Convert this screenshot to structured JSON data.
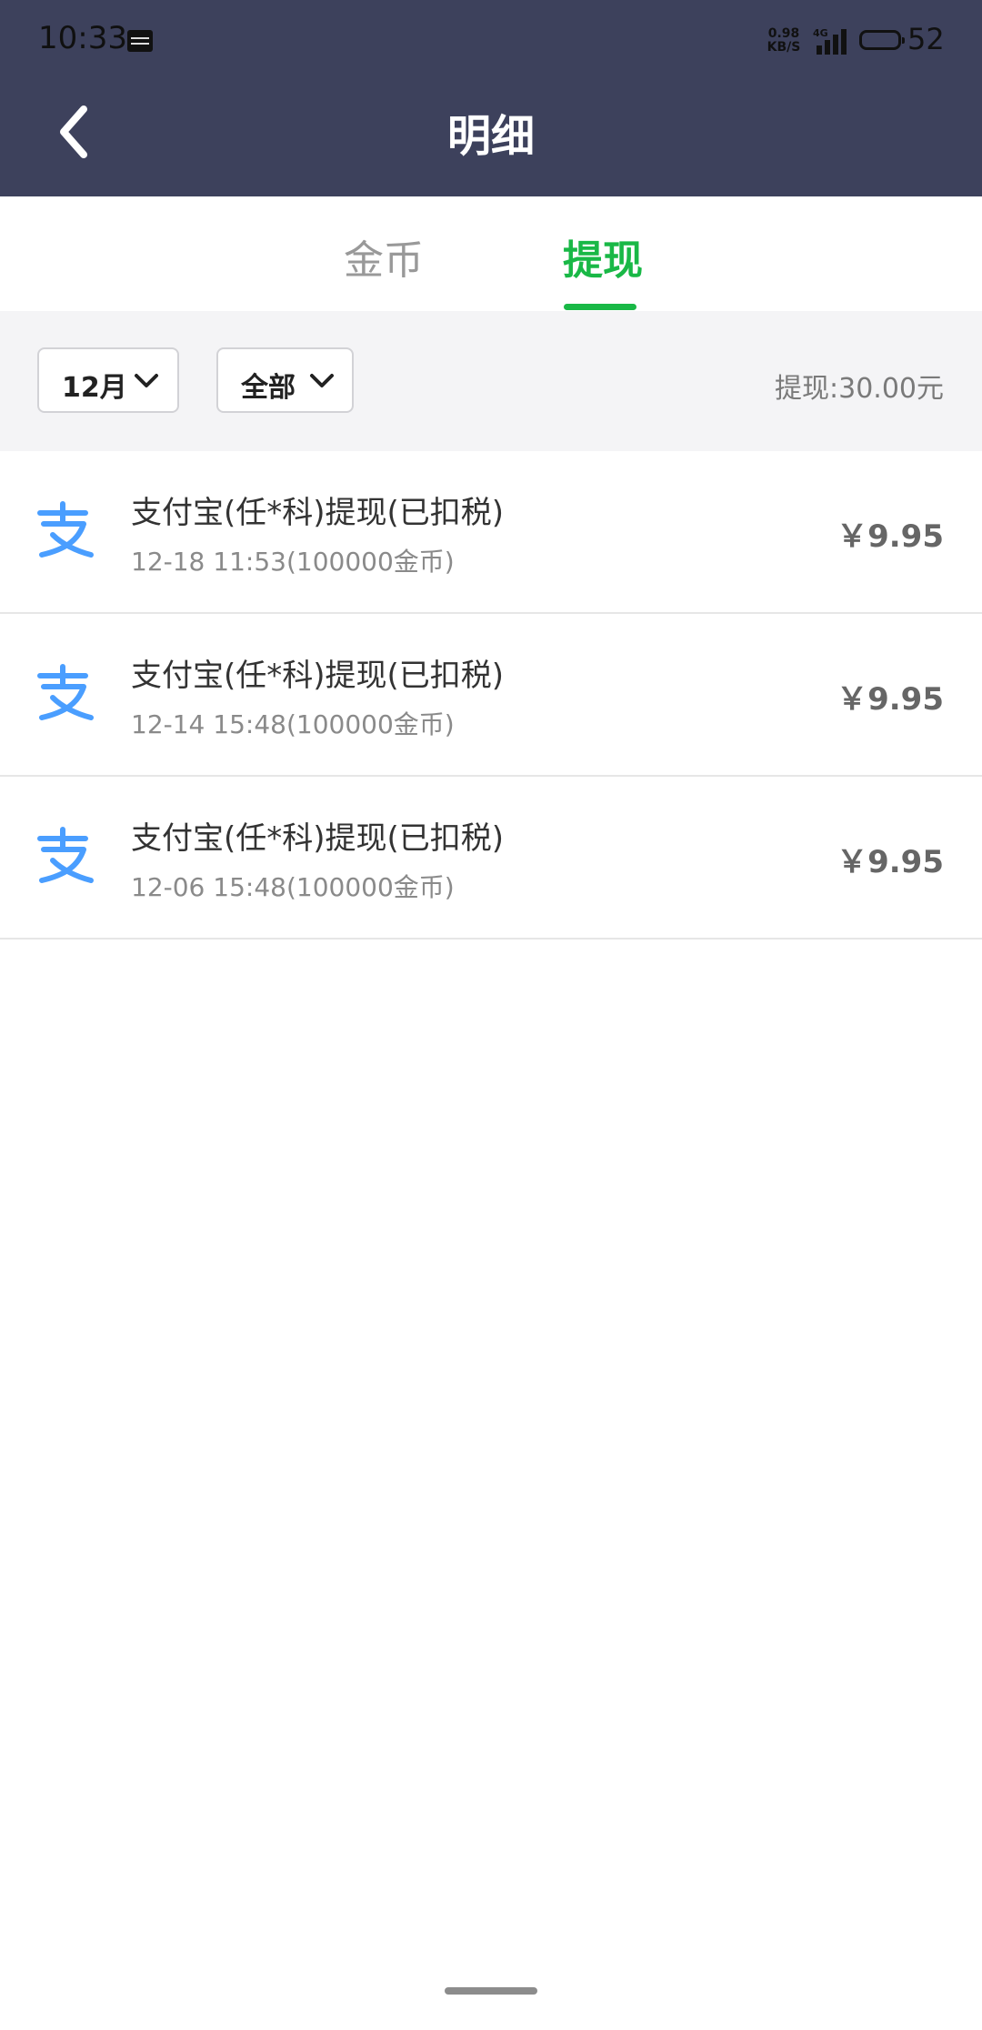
{
  "status_bar": {
    "time": "10:33",
    "net_speed_value": "0.98",
    "net_speed_unit": "KB/S",
    "network_type": "4G",
    "battery_level": "52"
  },
  "header": {
    "title": "明细"
  },
  "tabs": [
    {
      "label": "金币",
      "active": false
    },
    {
      "label": "提现",
      "active": true
    }
  ],
  "filters": {
    "month": "12月",
    "type": "全部",
    "total": "提现:30.00元"
  },
  "colors": {
    "header_bg": "#3d415c",
    "accent": "#19b846",
    "alipay_blue": "#4a9eff"
  },
  "records": [
    {
      "icon": "alipay-icon",
      "title": "支付宝(任*科)提现(已扣税)",
      "subtitle": "12-18 11:53(100000金币)",
      "amount": "￥9.95"
    },
    {
      "icon": "alipay-icon",
      "title": "支付宝(任*科)提现(已扣税)",
      "subtitle": "12-14 15:48(100000金币)",
      "amount": "￥9.95"
    },
    {
      "icon": "alipay-icon",
      "title": "支付宝(任*科)提现(已扣税)",
      "subtitle": "12-06 15:48(100000金币)",
      "amount": "￥9.95"
    }
  ]
}
